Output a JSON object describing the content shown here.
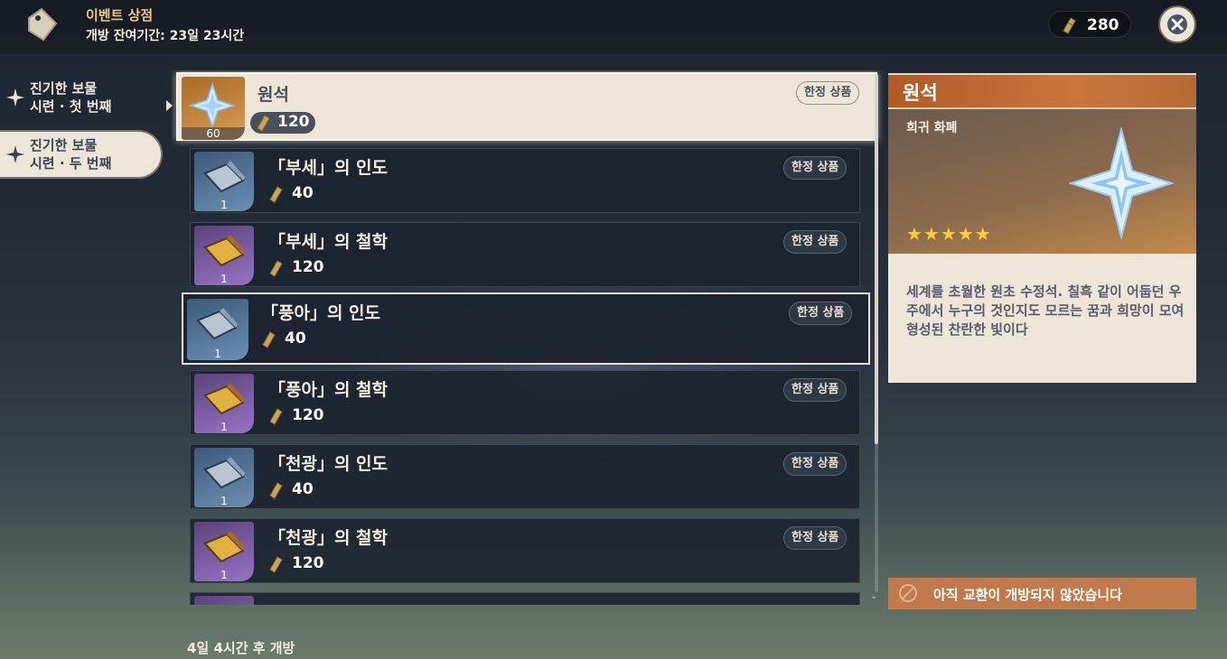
{
  "header": {
    "title": "이벤트 상점",
    "subtitle": "개방 잔여기간: 23일 23시간",
    "currency_amount": "280"
  },
  "tabs": [
    {
      "line1": "진기한 보물",
      "line2": "시련 · 첫 번째"
    },
    {
      "line1": "진기한 보물",
      "line2": "시련 · 두 번째"
    }
  ],
  "items": [
    {
      "name": "원석",
      "price": "120",
      "qty": "60",
      "badge": "한정 상품",
      "icon": "primogem-icon"
    },
    {
      "name": "「부세」의 인도",
      "price": "40",
      "qty": "1",
      "badge": "한정 상품",
      "icon": "guide-book-icon"
    },
    {
      "name": "「부세」의 철학",
      "price": "120",
      "qty": "1",
      "badge": "한정 상품",
      "icon": "philosophy-book-icon"
    },
    {
      "name": "「풍아」의 인도",
      "price": "40",
      "qty": "1",
      "badge": "한정 상품",
      "icon": "guide-book-icon"
    },
    {
      "name": "「풍아」의 철학",
      "price": "120",
      "qty": "1",
      "badge": "한정 상품",
      "icon": "philosophy-book-icon"
    },
    {
      "name": "「천광」의 인도",
      "price": "40",
      "qty": "1",
      "badge": "한정 상품",
      "icon": "guide-book-icon"
    },
    {
      "name": "「천광」의 철학",
      "price": "120",
      "qty": "1",
      "badge": "한정 상품",
      "icon": "philosophy-book-icon"
    }
  ],
  "footer": {
    "note": "4일 4시간 후 개방"
  },
  "detail": {
    "name": "원석",
    "type": "희귀 화폐",
    "rarity": 5,
    "stars_text": "★★★★★",
    "description": "세계를 초월한 원초 수정석. 칠흑 같이 어둡던 우주에서 누구의 것인지도 모르는 꿈과 희망이 모여 형성된 찬란한 빛이다",
    "exchange_status": "아직 교환이 개방되지 않았습니다"
  },
  "colors": {
    "accent": "#c17a4c",
    "selected_bg": "#ece5d8",
    "header_orange": "#c9753a"
  }
}
